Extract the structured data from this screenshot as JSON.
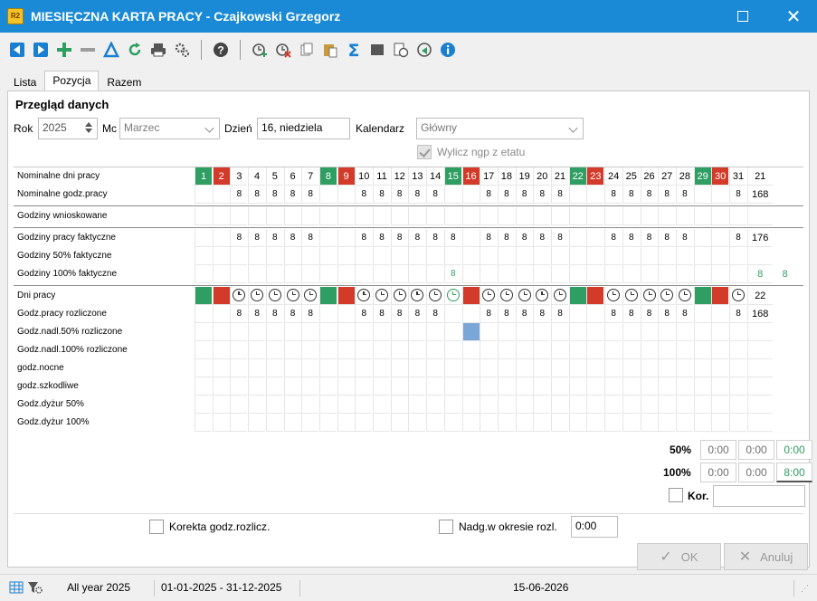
{
  "window": {
    "app_icon_text": "R2",
    "title": "MIESIĘCZNA KARTA PRACY - Czajkowski Grzegorz"
  },
  "toolbar": {
    "icons": [
      "prev-icon",
      "next-icon",
      "add-icon",
      "remove-icon",
      "edit-icon",
      "refresh-icon",
      "print-icon",
      "settings-icon",
      "help-icon",
      "add-time-icon",
      "delete-time-icon",
      "copy-icon",
      "paste-icon",
      "sum-icon",
      "fill-icon",
      "schedule-icon",
      "approve-icon",
      "info-icon"
    ]
  },
  "tabs": [
    "Lista",
    "Pozycja",
    "Razem"
  ],
  "header": {
    "section_title": "Przegląd danych",
    "rok_label": "Rok",
    "rok_value": "2025",
    "mc_label": "Mc",
    "mc_value": "Marzec",
    "dzien_label": "Dzień",
    "dzien_value": "16, niedziela",
    "kalendarz_label": "Kalendarz",
    "kalendarz_value": "Główny",
    "wylicz_label": "Wylicz ngp z etatu"
  },
  "grid": {
    "rows": [
      "Nominalne dni pracy",
      "Nominalne godz.pracy",
      "Godziny wnioskowane",
      "Godziny pracy faktyczne",
      "Godziny 50% faktyczne",
      "Godziny 100% faktyczne",
      "Dni pracy",
      "Godz.pracy rozliczone",
      "Godz.nadl.50% rozliczone",
      "Godz.nadl.100% rozliczone",
      "godz.nocne",
      "godz.szkodliwe",
      "Godz.dyżur 50%",
      "Godz.dyżur 100%"
    ],
    "days": [
      "1",
      "2",
      "3",
      "4",
      "5",
      "6",
      "7",
      "8",
      "9",
      "10",
      "11",
      "12",
      "13",
      "14",
      "15",
      "16",
      "17",
      "18",
      "19",
      "20",
      "21",
      "22",
      "23",
      "24",
      "25",
      "26",
      "27",
      "28",
      "29",
      "30",
      "31"
    ],
    "day_status": [
      "g",
      "r",
      "w",
      "w",
      "w",
      "w",
      "w",
      "g",
      "r",
      "w",
      "w",
      "w",
      "w",
      "w",
      "g",
      "r",
      "w",
      "w",
      "w",
      "w",
      "w",
      "g",
      "r",
      "w",
      "w",
      "w",
      "w",
      "w",
      "g",
      "r",
      "w"
    ],
    "hours_value": "8",
    "worked_extra_value": "8",
    "nominal_days_total": "21",
    "nominal_hours_total": "168",
    "actual_hours_total": "176",
    "hours100_total": "8",
    "hours100_extra": "8",
    "work_days_total": "22",
    "settled_hours_total": "168"
  },
  "summary": {
    "p50_label": "50%",
    "p50_values": [
      "0:00",
      "0:00",
      "0:00"
    ],
    "p100_label": "100%",
    "p100_values": [
      "0:00",
      "0:00",
      "8:00"
    ],
    "kor_label": "Kor."
  },
  "footer": {
    "korekta_label": "Korekta godz.rozlicz.",
    "nadg_label": "Nadg.w okresie rozl.",
    "nadg_value": "0:00",
    "ok_label": "OK",
    "cancel_label": "Anuluj"
  },
  "status": {
    "period_label": "All year 2025",
    "date_range": "01-01-2025 - 31-12-2025",
    "current_date": "15-06-2026"
  },
  "colors": {
    "titlebar": "#1a8ad6",
    "free_day": "#2f9e62",
    "holiday": "#d23b2a"
  }
}
